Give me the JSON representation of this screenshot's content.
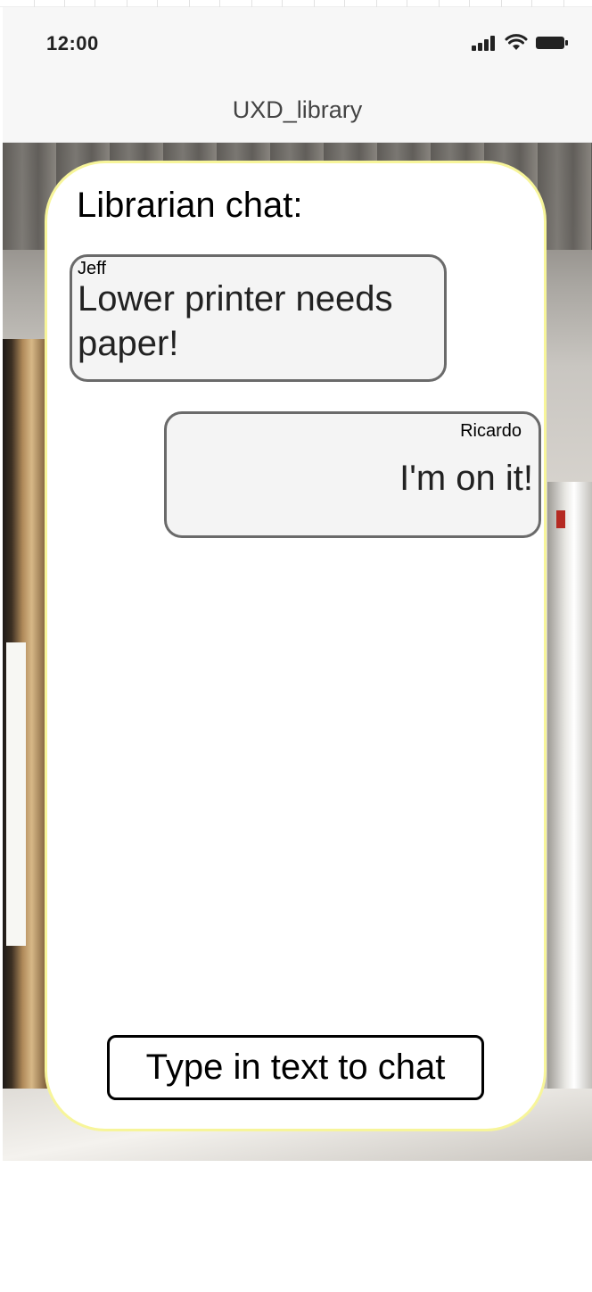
{
  "status_bar": {
    "time": "12:00",
    "icons": [
      "signal-icon",
      "wifi-icon",
      "battery-icon"
    ]
  },
  "nav": {
    "title": "UXD_library"
  },
  "chat": {
    "heading": "Librarian chat:",
    "messages": [
      {
        "sender": "Jeff",
        "text": "Lower printer needs paper!",
        "align": "left"
      },
      {
        "sender": "Ricardo",
        "text": "I'm on it!",
        "align": "right"
      }
    ],
    "input": {
      "placeholder": "Type in text to chat",
      "value": ""
    }
  },
  "colors": {
    "panel_border": "#f7f59a",
    "bubble_fill": "#f4f4f4",
    "bubble_border": "#6a6a6a",
    "bar_background": "#f7f7f7"
  }
}
